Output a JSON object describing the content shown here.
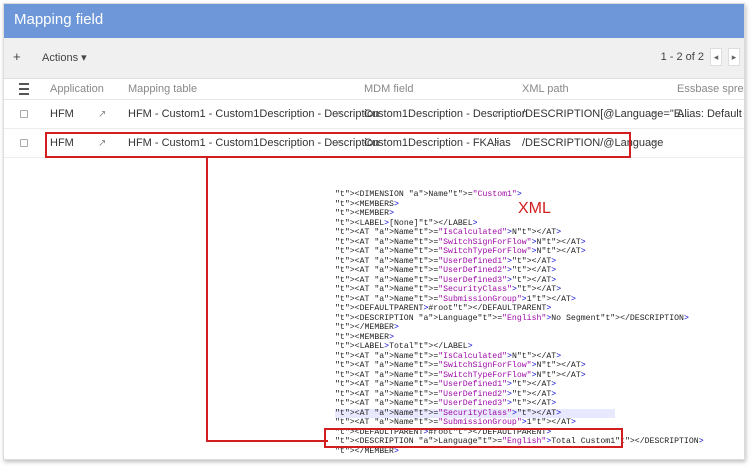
{
  "window": {
    "title": "Mapping field"
  },
  "toolbar": {
    "plus": "+",
    "actions_label": "Actions",
    "actions_caret": "▾",
    "page_info": "1 - 2 of 2",
    "prev": "◂",
    "next": "▸"
  },
  "table": {
    "columns": [
      "Application",
      "Mapping table",
      "MDM field",
      "XML path",
      "Essbase spread"
    ],
    "rows": [
      {
        "application": "HFM",
        "mapping_table": "HFM - Custom1 - Custom1Description - Description",
        "mdm_field": "Custom1Description - Description",
        "xml_path": "/DESCRIPTION[@Language=\"E...",
        "essbase": "Alias: Default"
      },
      {
        "application": "HFM",
        "mapping_table": "HFM - Custom1 - Custom1Description - Description",
        "mdm_field": "Custom1Description - FKAlias",
        "xml_path": "/DESCRIPTION/@Language",
        "essbase": ""
      }
    ]
  },
  "annotation": {
    "xml_label": "XML"
  },
  "xml_lines": [
    "<DIMENSION Name=\"Custom1\">",
    "<MEMBERS>",
    "<MEMBER>",
    "<LABEL>[None]</LABEL>",
    "<AT Name=\"IsCalculated\">N</AT>",
    "<AT Name=\"SwitchSignForFlow\">N</AT>",
    "<AT Name=\"SwitchTypeForFlow\">N</AT>",
    "<AT Name=\"UserDefined1\"></AT>",
    "<AT Name=\"UserDefined2\"></AT>",
    "<AT Name=\"UserDefined3\"></AT>",
    "<AT Name=\"SecurityClass\"></AT>",
    "<AT Name=\"SubmissionGroup\">1</AT>",
    "<DEFAULTPARENT>#root</DEFAULTPARENT>",
    "<DESCRIPTION Language=\"English\">No Segment</DESCRIPTION>",
    "</MEMBER>",
    "<MEMBER>",
    "<LABEL>Total</LABEL>",
    "<AT Name=\"IsCalculated\">N</AT>",
    "<AT Name=\"SwitchSignForFlow\">N</AT>",
    "<AT Name=\"SwitchTypeForFlow\">N</AT>",
    "<AT Name=\"UserDefined1\"></AT>",
    "<AT Name=\"UserDefined2\"></AT>",
    "<AT Name=\"UserDefined3\"></AT>",
    "<AT Name=\"SecurityClass\"></AT>",
    "<AT Name=\"SubmissionGroup\">1</AT>",
    "<DEFAULTPARENT>#root</DEFAULTPARENT>",
    "<DESCRIPTION Language=\"English\">Total Custom1</DESCRIPTION>",
    "</MEMBER>"
  ],
  "colors": {
    "header_blue": "#6d97d8",
    "highlight_red": "#d21e1e",
    "xml_tag": "#0000cc",
    "xml_attr": "#cc0000",
    "xml_value": "#9e0aa8"
  }
}
